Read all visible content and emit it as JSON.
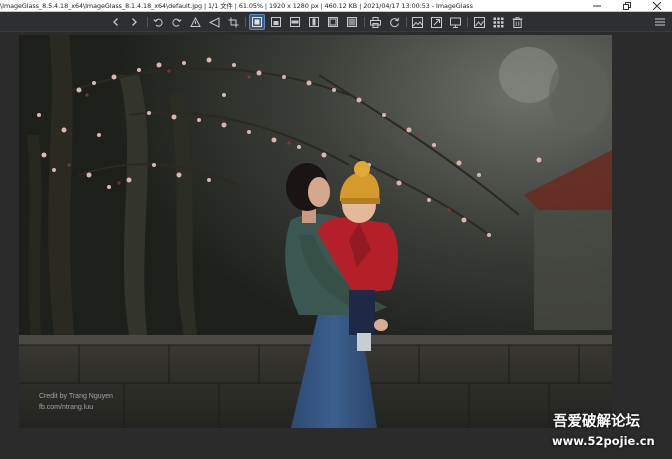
{
  "window": {
    "title": "\\ImageGlass_8.5.4.18_x64\\ImageGlass_8.1.4.18_x64\\default.jpg  |  1/1 文件  |  61.05%  |  1920 x 1280 px  |  460.12 KB  |  2021/04/17 13:00:53  -  ImageGlass"
  },
  "toolbar": {
    "buttons": [
      {
        "name": "previous-image-button",
        "icon": "chevron-left-icon"
      },
      {
        "name": "next-image-button",
        "icon": "chevron-right-icon"
      },
      {
        "name": "rotate-left-button",
        "icon": "rotate-left-icon"
      },
      {
        "name": "rotate-right-button",
        "icon": "rotate-right-icon"
      },
      {
        "name": "flip-vertical-button",
        "icon": "flip-vertical-icon"
      },
      {
        "name": "flip-horizontal-button",
        "icon": "flip-horizontal-icon"
      },
      {
        "name": "crop-button",
        "icon": "crop-icon"
      },
      {
        "name": "auto-zoom-button",
        "icon": "auto-zoom-icon",
        "active": true
      },
      {
        "name": "lock-zoom-button",
        "icon": "lock-zoom-icon"
      },
      {
        "name": "scale-to-width-button",
        "icon": "scale-width-icon"
      },
      {
        "name": "scale-to-height-button",
        "icon": "scale-height-icon"
      },
      {
        "name": "scale-to-fit-button",
        "icon": "scale-fit-icon"
      },
      {
        "name": "scale-to-fill-button",
        "icon": "scale-fill-icon"
      },
      {
        "name": "print-button",
        "icon": "print-icon"
      },
      {
        "name": "refresh-button",
        "icon": "refresh-icon"
      },
      {
        "name": "gallery-button",
        "icon": "image-gallery-icon"
      },
      {
        "name": "fullscreen-button",
        "icon": "fullscreen-icon"
      },
      {
        "name": "slideshow-button",
        "icon": "slideshow-icon"
      },
      {
        "name": "open-with-button",
        "icon": "open-image-icon"
      },
      {
        "name": "thumbnail-bar-button",
        "icon": "thumbnail-grid-icon"
      },
      {
        "name": "delete-button",
        "icon": "trash-icon"
      }
    ]
  },
  "photo": {
    "credit_line1": "Credit by Trang Nguyen",
    "credit_line2": "fb.com/ntrang.luu"
  },
  "watermark": {
    "line1": "吾爱破解论坛",
    "line2": "www.52pojie.cn"
  },
  "colors": {
    "toolbar_bg": "#2d2f33",
    "viewer_bg": "#2b2b2b",
    "active_button": "#3d5a78",
    "icon_color": "#c9c9c9"
  }
}
